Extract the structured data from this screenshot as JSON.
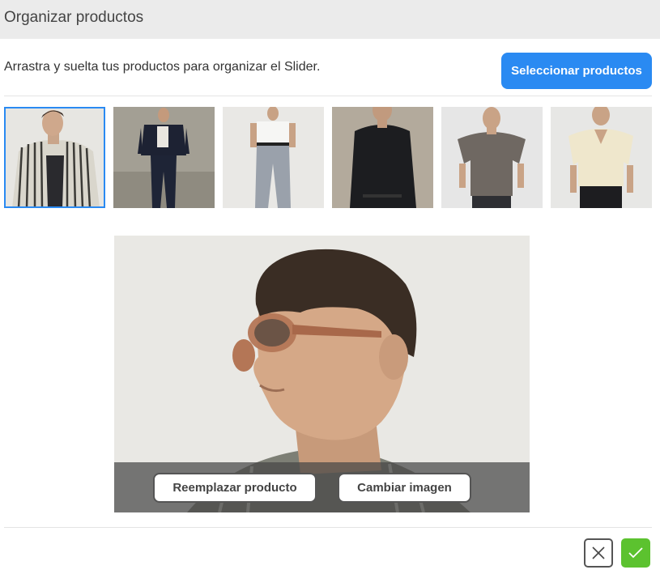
{
  "header": {
    "title": "Organizar productos"
  },
  "toolbar": {
    "instructions": "Arrastra y suelta tus productos para organizar el Slider.",
    "select_products_label": "Seleccionar productos",
    "accent_color": "#2a8af2"
  },
  "thumbnails": {
    "selected_index": 0,
    "items": [
      {
        "icon": "striped-shirt-model-image"
      },
      {
        "icon": "dark-jacket-model-image"
      },
      {
        "icon": "white-tee-model-image"
      },
      {
        "icon": "black-shirt-model-image"
      },
      {
        "icon": "grey-tee-model-image"
      },
      {
        "icon": "cream-shirt-model-image"
      }
    ]
  },
  "preview": {
    "replace_product_label": "Reemplazar producto",
    "change_image_label": "Cambiar imagen"
  },
  "footer": {
    "cancel_icon": "close-icon",
    "confirm_icon": "check-icon",
    "confirm_color": "#5cc22f"
  }
}
